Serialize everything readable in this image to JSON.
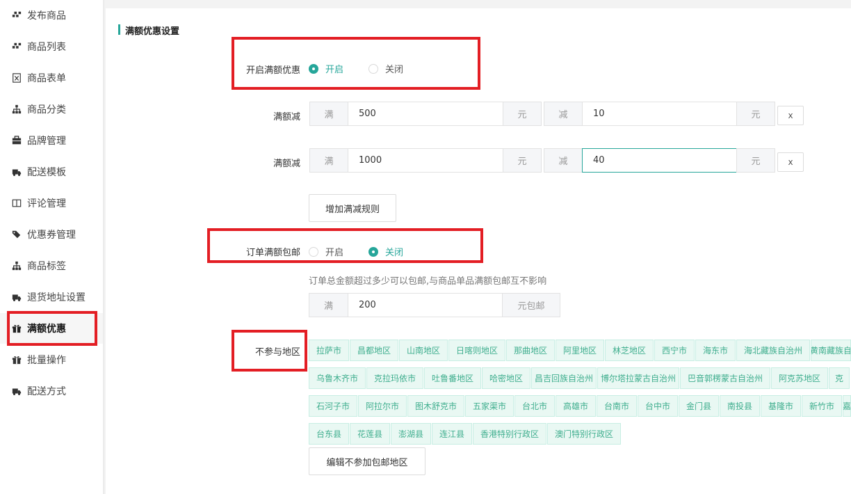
{
  "sidebar": {
    "items": [
      {
        "label": "发布商品",
        "icon": "cubes-icon"
      },
      {
        "label": "商品列表",
        "icon": "cubes-icon"
      },
      {
        "label": "商品表单",
        "icon": "excel-file-icon"
      },
      {
        "label": "商品分类",
        "icon": "sitemap-icon"
      },
      {
        "label": "品牌管理",
        "icon": "briefcase-icon"
      },
      {
        "label": "配送模板",
        "icon": "truck-icon"
      },
      {
        "label": "评论管理",
        "icon": "columns-icon"
      },
      {
        "label": "优惠券管理",
        "icon": "tags-icon"
      },
      {
        "label": "商品标签",
        "icon": "sitemap-icon"
      },
      {
        "label": "退货地址设置",
        "icon": "truck-icon"
      },
      {
        "label": "满额优惠",
        "icon": "gift-icon",
        "active": true
      },
      {
        "label": "批量操作",
        "icon": "gift-icon"
      },
      {
        "label": "配送方式",
        "icon": "truck-icon"
      }
    ]
  },
  "section_title": "满额优惠设置",
  "full_discount": {
    "label": "开启满额优惠",
    "on_label": "开启",
    "off_label": "关闭",
    "selected": "on"
  },
  "rules_label": "满额减",
  "rules": [
    {
      "prefix": "满",
      "amount": "500",
      "unit": "元",
      "minus": "减",
      "discount": "10",
      "unit2": "元",
      "remove": "x"
    },
    {
      "prefix": "满",
      "amount": "1000",
      "unit": "元",
      "minus": "减",
      "discount": "40",
      "unit2": "元",
      "remove": "x"
    }
  ],
  "add_rule_button": "增加满减规则",
  "free_shipping": {
    "label": "订单满额包邮",
    "on_label": "开启",
    "off_label": "关闭",
    "selected": "off",
    "hint": "订单总金额超过多少可以包邮,与商品单品满额包邮互不影响",
    "prefix": "满",
    "amount": "200",
    "suffix": "元包邮"
  },
  "excluded_regions": {
    "label": "不参与地区",
    "rows": [
      [
        "拉萨市",
        "昌都地区",
        "山南地区",
        "日喀则地区",
        "那曲地区",
        "阿里地区",
        "林芝地区",
        "西宁市",
        "海东市",
        "海北藏族自治州",
        "黄南藏族自"
      ],
      [
        "乌鲁木齐市",
        "克拉玛依市",
        "吐鲁番地区",
        "哈密地区",
        "昌吉回族自治州",
        "博尔塔拉蒙古自治州",
        "巴音郭楞蒙古自治州",
        "阿克苏地区",
        "克"
      ],
      [
        "石河子市",
        "阿拉尔市",
        "图木舒克市",
        "五家渠市",
        "台北市",
        "高雄市",
        "台南市",
        "台中市",
        "金门县",
        "南投县",
        "基隆市",
        "新竹市",
        "嘉"
      ],
      [
        "台东县",
        "花莲县",
        "澎湖县",
        "连江县",
        "香港特别行政区",
        "澳门特别行政区"
      ]
    ],
    "edit_button": "编辑不参加包邮地区"
  },
  "colors": {
    "accent": "#26a69a",
    "highlight": "#e31e24"
  }
}
